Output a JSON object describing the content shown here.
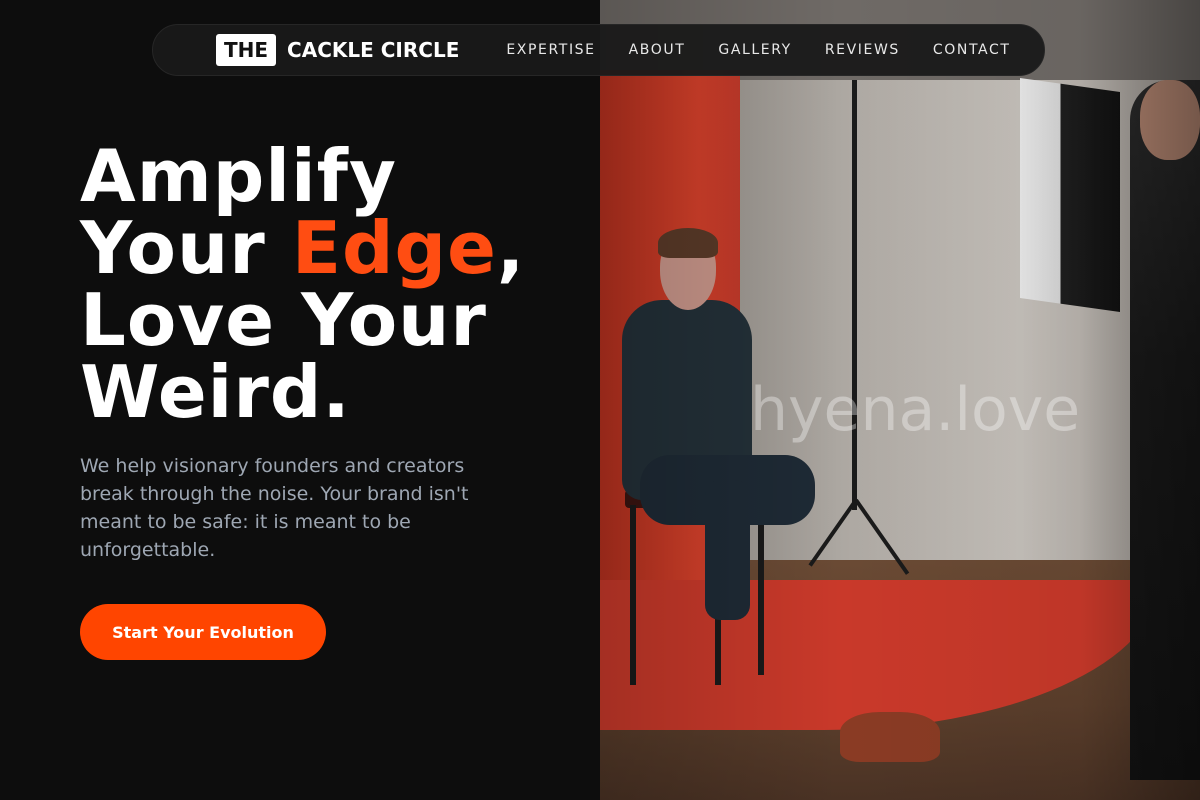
{
  "brand": {
    "badge": "THE",
    "name": "CACKLE CIRCLE"
  },
  "nav": {
    "items": [
      {
        "label": "EXPERTISE"
      },
      {
        "label": "ABOUT"
      },
      {
        "label": "GALLERY"
      },
      {
        "label": "REVIEWS"
      },
      {
        "label": "CONTACT"
      }
    ]
  },
  "hero": {
    "headline_line1": "Amplify",
    "headline_line2_pre": "Your ",
    "headline_accent": "Edge",
    "headline_line2_post": ",",
    "headline_line3": "Love Your",
    "headline_line4": "Weird.",
    "subtext": "We help visionary founders and creators break through the noise. Your brand isn't meant to be safe: it is meant to be unforgettable.",
    "cta_label": "Start Your Evolution"
  },
  "photo": {
    "watermark": "hyena.love"
  },
  "colors": {
    "accent": "#ff4d12",
    "button": "#ff4500",
    "background": "#0d0d0d",
    "subtext": "#9ea7b3"
  }
}
